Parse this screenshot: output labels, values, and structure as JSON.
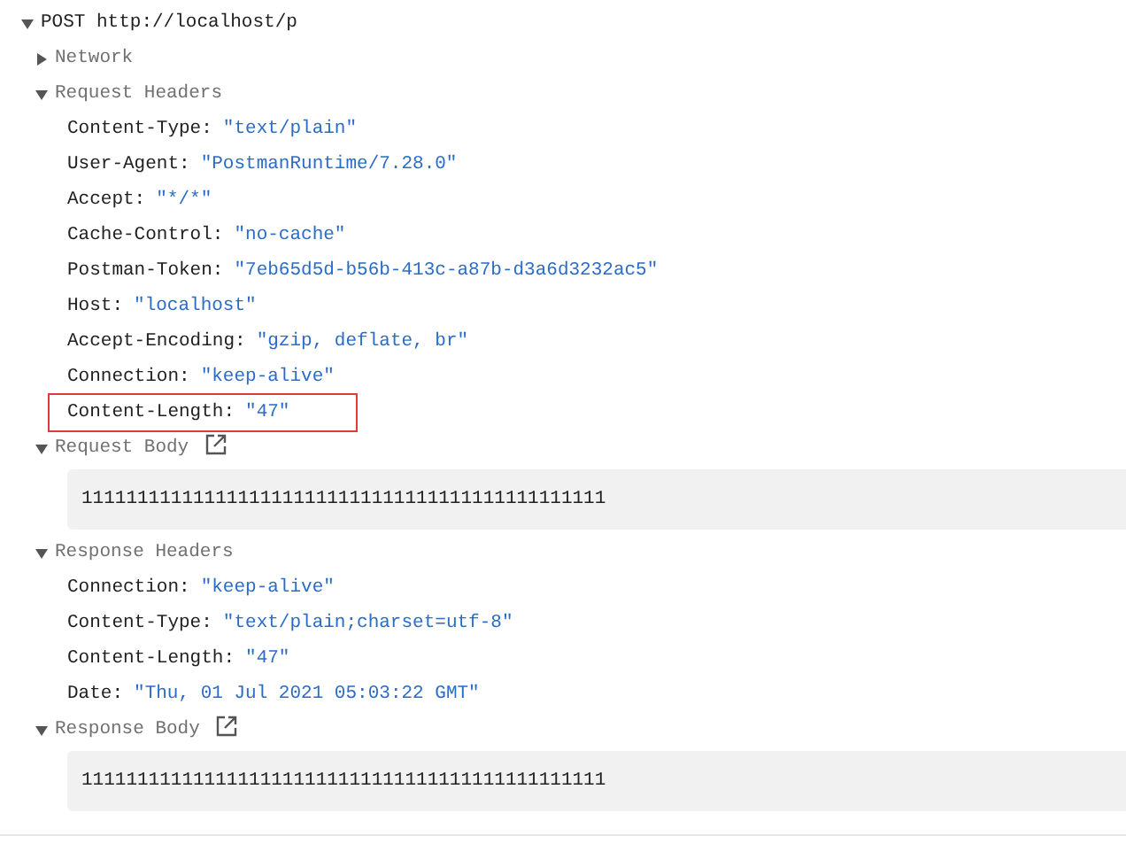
{
  "request": {
    "method": "POST",
    "url": "http://localhost/p",
    "expanded": true
  },
  "sections": [
    {
      "kind": "group",
      "title": "Network",
      "expanded": false
    },
    {
      "kind": "headers",
      "title": "Request Headers",
      "expanded": true,
      "headers": [
        {
          "name": "Content-Type:",
          "value": "\"text/plain\"",
          "highlighted": false
        },
        {
          "name": "User-Agent:",
          "value": "\"PostmanRuntime/7.28.0\"",
          "highlighted": false
        },
        {
          "name": "Accept:",
          "value": "\"*/*\"",
          "highlighted": false
        },
        {
          "name": "Cache-Control:",
          "value": "\"no-cache\"",
          "highlighted": false
        },
        {
          "name": "Postman-Token:",
          "value": "\"7eb65d5d-b56b-413c-a87b-d3a6d3232ac5\"",
          "highlighted": false
        },
        {
          "name": "Host:",
          "value": "\"localhost\"",
          "highlighted": false
        },
        {
          "name": "Accept-Encoding:",
          "value": "\"gzip, deflate, br\"",
          "highlighted": false
        },
        {
          "name": "Connection:",
          "value": "\"keep-alive\"",
          "highlighted": false
        },
        {
          "name": "Content-Length:",
          "value": "\"47\"",
          "highlighted": true
        }
      ]
    },
    {
      "kind": "body",
      "title": "Request Body",
      "expanded": true,
      "body": "11111111111111111111111111111111111111111111111"
    },
    {
      "kind": "headers",
      "title": "Response Headers",
      "expanded": true,
      "headers": [
        {
          "name": "Connection:",
          "value": "\"keep-alive\"",
          "highlighted": false
        },
        {
          "name": "Content-Type:",
          "value": "\"text/plain;charset=utf-8\"",
          "highlighted": false
        },
        {
          "name": "Content-Length:",
          "value": "\"47\"",
          "highlighted": false
        },
        {
          "name": "Date:",
          "value": "\"Thu, 01 Jul 2021 05:03:22 GMT\"",
          "highlighted": false
        }
      ]
    },
    {
      "kind": "body",
      "title": "Response Body",
      "expanded": true,
      "body": "11111111111111111111111111111111111111111111111"
    }
  ]
}
